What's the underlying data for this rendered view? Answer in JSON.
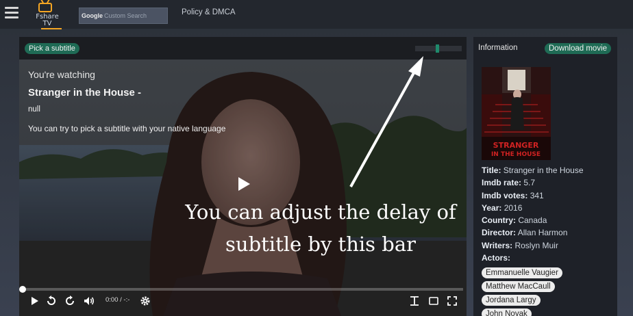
{
  "header": {
    "logo_text": "Fshare TV",
    "search_brand": "Google",
    "search_placeholder": "Custom Search",
    "nav_links": [
      "Policy & DMCA"
    ]
  },
  "player": {
    "subtitle_button": "Pick a subtitle",
    "subtitle_delay_level": 0.47,
    "watching_heading": "You're watching",
    "title": "Stranger in the House -",
    "subtitle_value": "null",
    "hint": "You can try to pick a subtitle with your native language",
    "annotation_line1": "You can adjust the delay of",
    "annotation_line2": "subtitle by this bar",
    "time_current": "0:00",
    "time_separator": "/",
    "time_total": "-:-",
    "progress": 0
  },
  "info": {
    "header": "Information",
    "download_button": "Download movie",
    "poster_title_line1": "STRANGER",
    "poster_title_line2": "IN THE HOUSE",
    "fields": [
      {
        "label": "Title:",
        "value": "Stranger in the House"
      },
      {
        "label": "Imdb rate:",
        "value": "5.7"
      },
      {
        "label": "Imdb votes:",
        "value": "341"
      },
      {
        "label": "Year:",
        "value": "2016"
      },
      {
        "label": "Country:",
        "value": "Canada"
      },
      {
        "label": "Director:",
        "value": "Allan Harmon"
      },
      {
        "label": "Writers:",
        "value": "Roslyn Muir"
      }
    ],
    "actors_label": "Actors:",
    "actors": [
      "Emmanuelle Vaugier",
      "Matthew MacCaull",
      "Jordana Largy",
      "John Novak"
    ]
  },
  "colors": {
    "accent": "#1f6b55",
    "background": "#2b3038",
    "panel": "#1b1d21"
  },
  "icons": [
    "hamburger-menu-icon",
    "tv-logo-icon",
    "play-icon",
    "replay-icon",
    "forward-icon",
    "volume-icon",
    "settings-gear-icon",
    "subtitles-text-icon",
    "picture-in-picture-icon",
    "fullscreen-icon"
  ]
}
